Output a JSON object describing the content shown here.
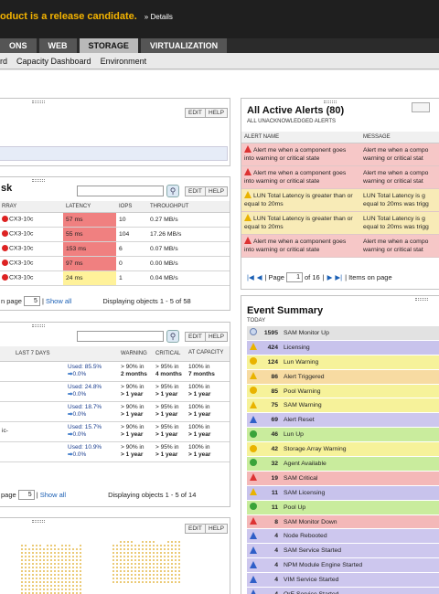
{
  "banner": {
    "message": "oduct is a release candidate.",
    "details": "» Details"
  },
  "tabs": [
    "ONS",
    "WEB",
    "STORAGE",
    "VIRTUALIZATION"
  ],
  "active_tab": "STORAGE",
  "subnav": [
    "rd",
    "Capacity Dashboard",
    "Environment"
  ],
  "buttons": {
    "edit": "EDIT",
    "help": "HELP"
  },
  "top_left_panel": {},
  "latency_panel": {
    "title": "sk",
    "columns": [
      "RRAY",
      "LATENCY",
      "IOPS",
      "THROUGHPUT"
    ],
    "rows": [
      {
        "array": "CX3-10c",
        "latency": "57 ms",
        "iops": "10",
        "throughput": "0.27 MB/s",
        "level": "red"
      },
      {
        "array": "CX3-10c",
        "latency": "55 ms",
        "iops": "104",
        "throughput": "17.26 MB/s",
        "level": "red"
      },
      {
        "array": "CX3-10c",
        "latency": "153 ms",
        "iops": "6",
        "throughput": "0.07 MB/s",
        "level": "red"
      },
      {
        "array": "CX3-10c",
        "latency": "97 ms",
        "iops": "0",
        "throughput": "0.00 MB/s",
        "level": "red"
      },
      {
        "array": "CX3-10c",
        "latency": "24 ms",
        "iops": "1",
        "throughput": "0.04 MB/s",
        "level": "yellow"
      }
    ],
    "footer_prefix": "n page",
    "page_size": "5",
    "show_all": "Show all",
    "displaying": "Displaying objects 1 - 5 of 58"
  },
  "capacity_panel": {
    "columns": [
      "LAST 7 DAYS",
      "WARNING",
      "CRITICAL",
      "AT CAPACITY"
    ],
    "rows": [
      {
        "label": "",
        "used": "Used: 85.5%",
        "change": "0.0%",
        "warning": [
          "> 90% in",
          "2 months"
        ],
        "critical": [
          "> 95% in",
          "4 months"
        ],
        "capacity": [
          "100% in",
          "7 months"
        ]
      },
      {
        "label": "",
        "used": "Used: 24.8%",
        "change": "0.0%",
        "warning": [
          "> 90% in",
          "> 1 year"
        ],
        "critical": [
          "> 95% in",
          "> 1 year"
        ],
        "capacity": [
          "100% in",
          "> 1 year"
        ]
      },
      {
        "label": "",
        "used": "Used: 18.7%",
        "change": "0.0%",
        "warning": [
          "> 90% in",
          "> 1 year"
        ],
        "critical": [
          "> 95% in",
          "> 1 year"
        ],
        "capacity": [
          "100% in",
          "> 1 year"
        ]
      },
      {
        "label": "ic-",
        "used": "Used: 15.7%",
        "change": "0.0%",
        "warning": [
          "> 90% in",
          "> 1 year"
        ],
        "critical": [
          "> 95% in",
          "> 1 year"
        ],
        "capacity": [
          "100% in",
          "> 1 year"
        ]
      },
      {
        "label": "",
        "used": "Used: 10.9%",
        "change": "0.0%",
        "warning": [
          "> 90% in",
          "> 1 year"
        ],
        "critical": [
          "> 95% in",
          "> 1 year"
        ],
        "capacity": [
          "100% in",
          "> 1 year"
        ]
      }
    ],
    "footer_prefix": "page",
    "page_size": "5",
    "show_all": "Show all",
    "displaying": "Displaying objects 1 - 5 of 14"
  },
  "alerts_panel": {
    "title": "All Active Alerts (80)",
    "subtitle": "ALL UNACKNOWLEDGED ALERTS",
    "columns": [
      "ALERT NAME",
      "MESSAGE"
    ],
    "rows": [
      {
        "name": "Alert me when a component goes into warning or critical state",
        "message": "Alert me when a compo warning or critical stat",
        "icon": "red-triangle-icon",
        "color": "red"
      },
      {
        "name": "Alert me when a component goes into warning or critical state",
        "message": "Alert me when a compo warning or critical stat",
        "icon": "red-triangle-icon",
        "color": "red"
      },
      {
        "name": "LUN Total Latency is greater than or equal to 20ms",
        "message": "LUN Total Latency is g equal to 20ms was trigg",
        "icon": "yellow-triangle-icon",
        "color": "yellow"
      },
      {
        "name": "LUN Total Latency is greater than or equal to 20ms",
        "message": "LUN Total Latency is g equal to 20ms was trigg",
        "icon": "yellow-triangle-icon",
        "color": "yellow"
      },
      {
        "name": "Alert me when a component goes into warning or critical state",
        "message": "Alert me when a compo warning or critical stat",
        "icon": "red-triangle-icon",
        "color": "red"
      }
    ],
    "pager_page": "Page",
    "pager_current": "1",
    "pager_of": "of 16",
    "items_on_page": "Items on page"
  },
  "event_summary": {
    "title": "Event Summary",
    "subtitle": "TODAY",
    "events": [
      {
        "count": "1595",
        "name": "SAM Monitor Up",
        "icon": "info-icon",
        "color": "grey"
      },
      {
        "count": "424",
        "name": "Licensing",
        "icon": "warning-triangle-icon",
        "color": "purple"
      },
      {
        "count": "124",
        "name": "Lun Warning",
        "icon": "warning-circle-icon",
        "color": "yellow"
      },
      {
        "count": "86",
        "name": "Alert Triggered",
        "icon": "warning-triangle-icon",
        "color": "orange"
      },
      {
        "count": "85",
        "name": "Pool Warning",
        "icon": "warning-circle-icon",
        "color": "yellow"
      },
      {
        "count": "75",
        "name": "SAM Warning",
        "icon": "warning-triangle-icon",
        "color": "yellow"
      },
      {
        "count": "69",
        "name": "Alert Reset",
        "icon": "blue-triangle-icon",
        "color": "lavender"
      },
      {
        "count": "46",
        "name": "Lun Up",
        "icon": "green-circle-icon",
        "color": "green"
      },
      {
        "count": "42",
        "name": "Storage Array Warning",
        "icon": "warning-circle-icon",
        "color": "yellow"
      },
      {
        "count": "32",
        "name": "Agent Available",
        "icon": "green-circle-icon",
        "color": "green"
      },
      {
        "count": "19",
        "name": "SAM Critical",
        "icon": "red-triangle-icon",
        "color": "red"
      },
      {
        "count": "11",
        "name": "SAM Licensing",
        "icon": "warning-triangle-icon",
        "color": "purple"
      },
      {
        "count": "11",
        "name": "Pool Up",
        "icon": "green-circle-icon",
        "color": "green"
      },
      {
        "count": "8",
        "name": "SAM Monitor Down",
        "icon": "red-triangle-icon",
        "color": "red"
      },
      {
        "count": "4",
        "name": "Node Rebooted",
        "icon": "blue-triangle-icon",
        "color": "lavender"
      },
      {
        "count": "4",
        "name": "SAM Service Started",
        "icon": "blue-triangle-icon",
        "color": "lavender"
      },
      {
        "count": "4",
        "name": "NPM Module Engine Started",
        "icon": "blue-triangle-icon",
        "color": "lavender"
      },
      {
        "count": "4",
        "name": "VIM Service Started",
        "icon": "blue-triangle-icon",
        "color": "lavender"
      },
      {
        "count": "4",
        "name": "OrE Service Started",
        "icon": "blue-triangle-icon",
        "color": "lavender"
      }
    ]
  },
  "colors": {
    "banner": "#f5b400",
    "topbar": "#1f1f1f",
    "latency_red": "#f08080",
    "latency_yellow": "#fff29a",
    "link": "#1a5fb4"
  }
}
